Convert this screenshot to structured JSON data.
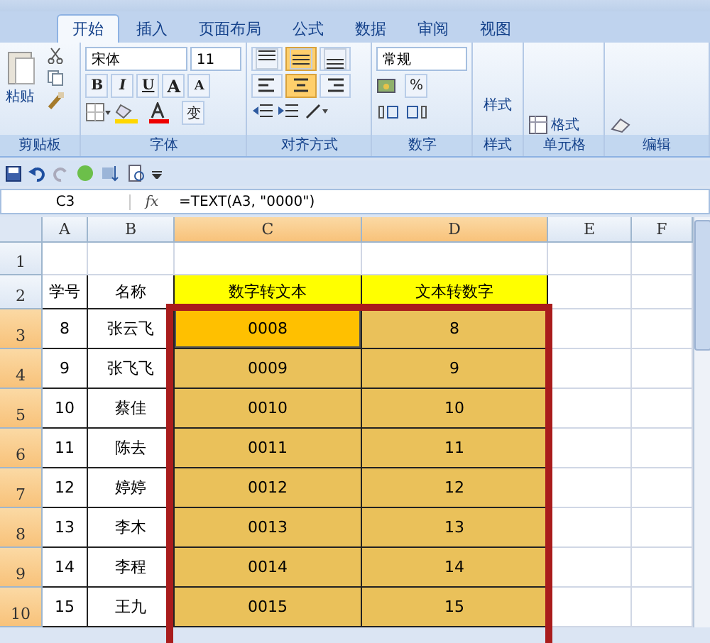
{
  "tabs": [
    {
      "label": "开始",
      "selected": true
    },
    {
      "label": "插入",
      "selected": false
    },
    {
      "label": "页面布局",
      "selected": false
    },
    {
      "label": "公式",
      "selected": false
    },
    {
      "label": "数据",
      "selected": false
    },
    {
      "label": "审阅",
      "selected": false
    },
    {
      "label": "视图",
      "selected": false
    }
  ],
  "ribbon": {
    "clipboard": {
      "label": "剪贴板",
      "paste": "粘贴"
    },
    "font": {
      "label": "字体",
      "name": "宋体",
      "size": "11",
      "bold": "B",
      "italic": "I",
      "underline": "U",
      "grow": "A",
      "shrink": "A",
      "phonetic": "变"
    },
    "alignment": {
      "label": "对齐方式",
      "buttons": [
        {
          "kind": "top",
          "on": false
        },
        {
          "kind": "middle",
          "on": true
        },
        {
          "kind": "bottom",
          "on": false
        },
        {
          "kind": "left",
          "on": false
        },
        {
          "kind": "center",
          "on": true
        },
        {
          "kind": "right",
          "on": false
        }
      ]
    },
    "number": {
      "label": "数字",
      "format": "常规",
      "percent": "%"
    },
    "styles": {
      "button": "样式",
      "label": "样式"
    },
    "cells": {
      "label": "单元格",
      "format": "格式"
    },
    "editing": {
      "label": "编辑"
    }
  },
  "formula_bar": {
    "name_box": "C3",
    "fx": "fx",
    "formula": "=TEXT(A3, \"0000\")"
  },
  "columns": [
    {
      "label": "A",
      "selected": false
    },
    {
      "label": "B",
      "selected": false
    },
    {
      "label": "C",
      "selected": true
    },
    {
      "label": "D",
      "selected": true
    },
    {
      "label": "E",
      "selected": false
    },
    {
      "label": "F",
      "selected": false
    }
  ],
  "rows": [
    {
      "header": "1",
      "selected": false,
      "cells": []
    },
    {
      "header": "2",
      "selected": false,
      "cells": [
        {
          "text": "学号"
        },
        {
          "text": "名称"
        },
        {
          "text": "数字转文本",
          "color": "#ffff00"
        },
        {
          "text": "文本转数字",
          "color": "#ffff00"
        }
      ]
    },
    {
      "header": "3",
      "selected": true,
      "cells": [
        {
          "text": "8"
        },
        {
          "text": "张云飞"
        },
        {
          "text": "0008",
          "selected": true,
          "active": true
        },
        {
          "text": "8",
          "selected": true
        }
      ]
    },
    {
      "header": "4",
      "selected": true,
      "cells": [
        {
          "text": "9"
        },
        {
          "text": "张飞飞"
        },
        {
          "text": "0009",
          "selected": true
        },
        {
          "text": "9",
          "selected": true
        }
      ]
    },
    {
      "header": "5",
      "selected": true,
      "cells": [
        {
          "text": "10"
        },
        {
          "text": "蔡佳"
        },
        {
          "text": "0010",
          "selected": true
        },
        {
          "text": "10",
          "selected": true
        }
      ]
    },
    {
      "header": "6",
      "selected": true,
      "cells": [
        {
          "text": "11"
        },
        {
          "text": "陈去"
        },
        {
          "text": "0011",
          "selected": true
        },
        {
          "text": "11",
          "selected": true
        }
      ]
    },
    {
      "header": "7",
      "selected": true,
      "cells": [
        {
          "text": "12"
        },
        {
          "text": "婷婷"
        },
        {
          "text": "0012",
          "selected": true
        },
        {
          "text": "12",
          "selected": true
        }
      ]
    },
    {
      "header": "8",
      "selected": true,
      "cells": [
        {
          "text": "13"
        },
        {
          "text": "李木"
        },
        {
          "text": "0013",
          "selected": true
        },
        {
          "text": "13",
          "selected": true
        }
      ]
    },
    {
      "header": "9",
      "selected": true,
      "cells": [
        {
          "text": "14"
        },
        {
          "text": "李程"
        },
        {
          "text": "0014",
          "selected": true
        },
        {
          "text": "14",
          "selected": true
        }
      ]
    },
    {
      "header": "10",
      "selected": true,
      "cells": [
        {
          "text": "15"
        },
        {
          "text": "王九"
        },
        {
          "text": "0015",
          "selected": true
        },
        {
          "text": "15",
          "selected": true
        }
      ]
    }
  ],
  "annotation_frame": true
}
